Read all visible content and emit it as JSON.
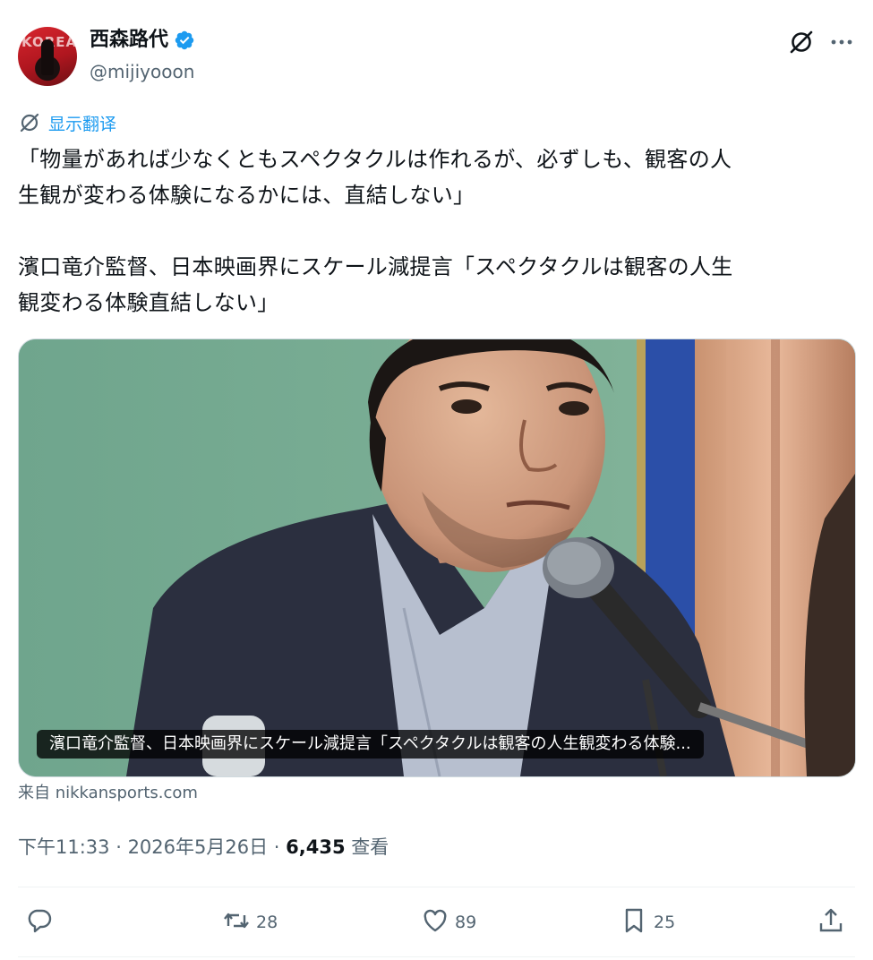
{
  "author": {
    "display_name": "西森路代",
    "handle": "@mijiyooon",
    "verified": true,
    "avatar_text": "KOREAN"
  },
  "header_actions": {
    "grok_icon": "grok-icon",
    "more_icon": "more-dots-icon"
  },
  "translate": {
    "icon": "translate-icon",
    "label": "显示翻译"
  },
  "post": {
    "paragraph1_line1": "「物量があれば少なくともスペクタクルは作れるが、必ずしも、観客の人",
    "paragraph1_line2": "生観が変わる体験になるかには、直結しない」",
    "paragraph2_line1": "濱口竜介監督、日本映画界にスケール減提言「スペクタクルは観客の人生",
    "paragraph2_line2": "観変わる体験直結しない」"
  },
  "link_card": {
    "caption": "濱口竜介監督、日本映画界にスケール減提言「スペクタクルは観客の人生観変わる体験...",
    "source": "来自 nikkansports.com"
  },
  "meta": {
    "time": "下午11:33",
    "sep1": " · ",
    "date": "2026年5月26日",
    "sep2": " · ",
    "views": "6,435",
    "views_label": " 查看"
  },
  "actions": {
    "reply": {
      "icon": "reply-icon",
      "count": ""
    },
    "retweet": {
      "icon": "retweet-icon",
      "count": "28"
    },
    "like": {
      "icon": "heart-icon",
      "count": "89"
    },
    "bookmark": {
      "icon": "bookmark-icon",
      "count": "25"
    },
    "share": {
      "icon": "share-icon",
      "count": ""
    }
  },
  "colors": {
    "accent": "#1d9bf0",
    "text_primary": "#0f1419",
    "text_secondary": "#536471"
  }
}
